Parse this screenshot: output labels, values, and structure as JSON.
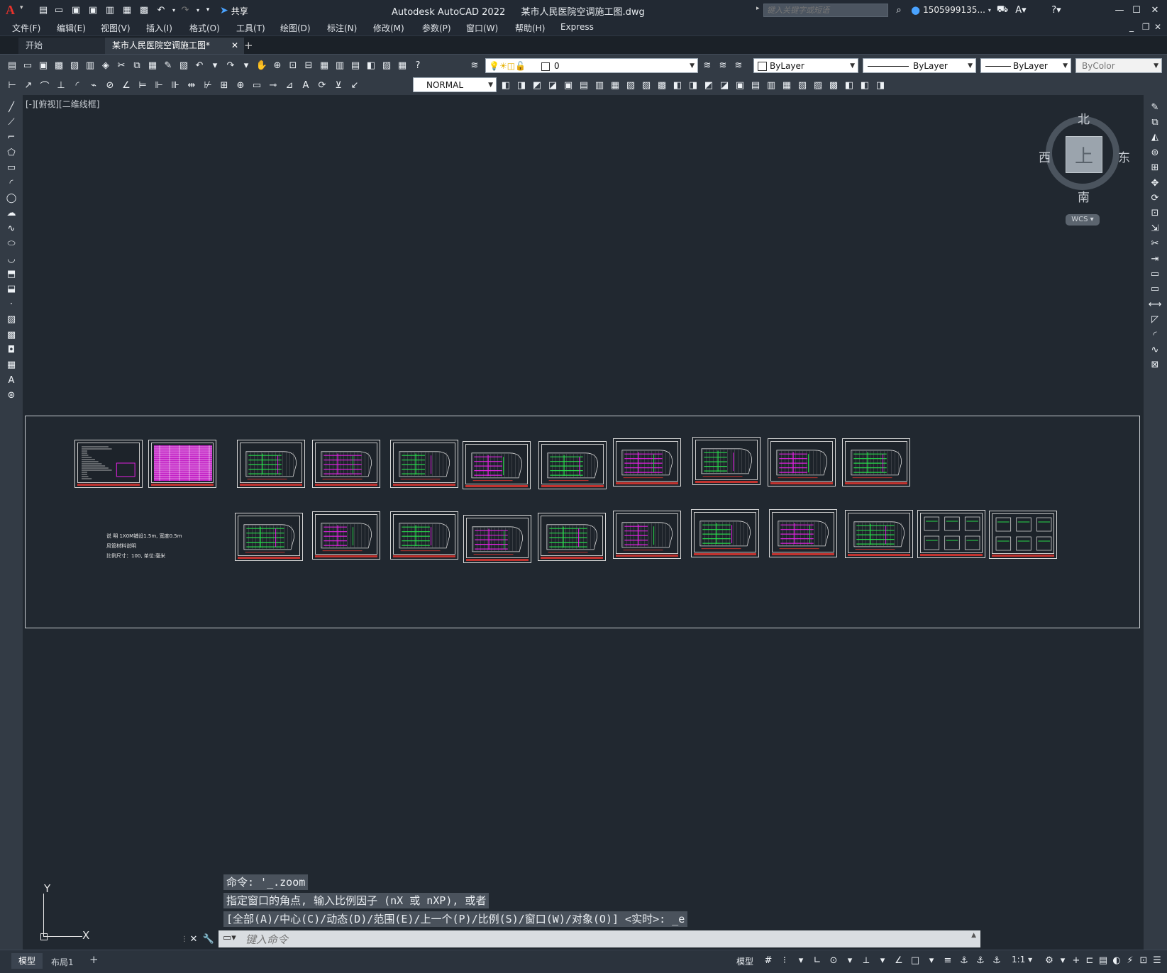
{
  "titlebar": {
    "app_title": "Autodesk AutoCAD 2022",
    "file_title": "某市人民医院空调施工图.dwg",
    "share_label": "共享",
    "search_placeholder": "键入关键字或短语",
    "user": "1505999135...",
    "minimize": "—",
    "maximize": "☐",
    "close": "✕"
  },
  "menu": {
    "items": [
      "文件(F)",
      "编辑(E)",
      "视图(V)",
      "插入(I)",
      "格式(O)",
      "工具(T)",
      "绘图(D)",
      "标注(N)",
      "修改(M)",
      "参数(P)",
      "窗口(W)",
      "帮助(H)",
      "Express"
    ]
  },
  "tabs": {
    "start": "开始",
    "active": "某市人民医院空调施工图*",
    "add": "+"
  },
  "toolbar": {
    "layer_value": "0",
    "color_value": "ByLayer",
    "linetype_value": "ByLayer",
    "lineweight_value": "ByLayer",
    "plotstyle_value": "ByColor",
    "dimstyle_value": "NORMAL"
  },
  "viewport": {
    "label": "[-][俯视][二维线框]",
    "compass": {
      "north": "北",
      "south": "南",
      "east": "东",
      "west": "西",
      "top": "上",
      "wcs": "WCS"
    },
    "ucs": {
      "x": "X",
      "y": "Y"
    },
    "note_lines": [
      "说  明  1X0M铺设1.5m, 宽度0.5m",
      "风管材料说明",
      "比例尺寸：100, 单位:毫米"
    ]
  },
  "command": {
    "history": [
      "命令: '_.zoom",
      "指定窗口的角点, 输入比例因子 (nX 或 nXP), 或者",
      "[全部(A)/中心(C)/动态(D)/范围(E)/上一个(P)/比例(S)/窗口(W)/对象(O)] <实时>: _e"
    ],
    "placeholder": "键入命令"
  },
  "layout_tabs": {
    "model": "模型",
    "layout1": "布局1",
    "add": "+"
  },
  "statusbar": {
    "model": "模型",
    "scale": "1:1"
  },
  "colors": {
    "accent": "#2a7fd4",
    "canvas": "#212830",
    "panel": "#333b45",
    "red": "#c2332f",
    "magenta": "#e020e0",
    "green": "#27d84a"
  }
}
